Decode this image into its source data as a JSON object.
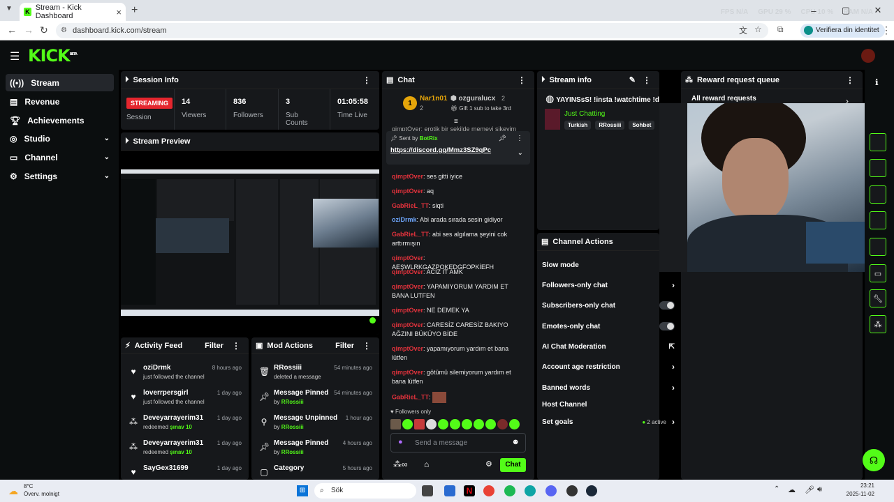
{
  "browser": {
    "tab_title": "Stream - Kick Dashboard",
    "url": "dashboard.kick.com/stream",
    "verify_label": "Verifiera din identitet",
    "stats": [
      "FPS N/A",
      "GPU 29 %",
      "CPU 10 %",
      "RAM N/A"
    ]
  },
  "kick": {
    "logo": "KICK",
    "logo_sup": "BETA"
  },
  "sidebar": {
    "items": [
      {
        "label": "Stream"
      },
      {
        "label": "Revenue"
      },
      {
        "label": "Achievements"
      },
      {
        "label": "Studio"
      },
      {
        "label": "Channel"
      },
      {
        "label": "Settings"
      }
    ]
  },
  "session": {
    "title": "Session Info",
    "badge": "STREAMING",
    "session_label": "Session",
    "viewers": "14",
    "viewers_label": "Viewers",
    "followers": "836",
    "followers_label": "Followers",
    "subs": "3",
    "subs_label": "Sub Counts",
    "time": "01:05:58",
    "time_label": "Time Live"
  },
  "preview": {
    "title": "Stream Preview"
  },
  "activity": {
    "title": "Activity Feed",
    "filter": "Filter",
    "rows": [
      {
        "who": "oziDrmk",
        "what": "just followed the channel",
        "when": "8 hours ago"
      },
      {
        "who": "loverrpersgirl",
        "what": "just followed the channel",
        "when": "1 day ago"
      },
      {
        "who": "Deveyarrayerim31",
        "what": "redeemed",
        "reward": "şınav 10",
        "when": "1 day ago"
      },
      {
        "who": "Deveyarrayerim31",
        "what": "redeemed",
        "reward": "şınav 10",
        "when": "1 day ago"
      },
      {
        "who": "SayGex31699",
        "what": "",
        "when": "1 day ago"
      }
    ]
  },
  "mod": {
    "title": "Mod Actions",
    "filter": "Filter",
    "rows": [
      {
        "who": "RRossiii",
        "what": "deleted a message",
        "when": "54 minutes ago"
      },
      {
        "who": "Message Pinned",
        "what": "by",
        "by": "RRossiii",
        "when": "54 minutes ago"
      },
      {
        "who": "Message Unpinned",
        "what": "by",
        "by": "RRossiii",
        "when": "1 hour ago"
      },
      {
        "who": "Message Pinned",
        "what": "by",
        "by": "RRossiii",
        "when": "4 hours ago"
      },
      {
        "who": "Category",
        "what": "",
        "when": "5 hours ago"
      }
    ]
  },
  "chat": {
    "title": "Chat",
    "top1_name": "Nar1n01",
    "top1_count": "2",
    "top2_name": "ozguralucx",
    "top2_count": "2",
    "gift_text": "Gift 1 sub to take 3rd",
    "pinned_sent_by": "Sent by",
    "pinned_user": "BotRix",
    "pinned_link": "https://discord.gg/Mmz3SZ9qPc",
    "partial_top": "qimptOver: erotik bir şekilde memeyi sikeyim",
    "messages": [
      {
        "user": "qimptOver",
        "text": "ses gitti iyice"
      },
      {
        "user": "qimptOver",
        "text": "aq"
      },
      {
        "user": "GabRieL_TT",
        "text": "siqti"
      },
      {
        "user": "oziDrmk",
        "text": "Abi arada sırada sesin gidiyor"
      },
      {
        "user": "GabRieL_TT",
        "text": "abi ses algılama şeyini cok arttırmışın"
      },
      {
        "user": "qimptOver",
        "text": "AEŞWLRKGAZPOKEDGFOPKİEFH"
      },
      {
        "user": "qimptOver",
        "text": "ACİZ İT AMK"
      },
      {
        "user": "qimptOver",
        "text": "YAPAMIYORUM YARDIM ET BANA LUTFEN"
      },
      {
        "user": "qimptOver",
        "text": "NE DEMEK YA"
      },
      {
        "user": "qimptOver",
        "text": "CARESİZ CARESİZ BAKIYO AĞZINI BÜKÜYO BİDE"
      },
      {
        "user": "qimptOver",
        "text": "yapamıyorum yardım et bana lütfen"
      },
      {
        "user": "qimptOver",
        "text": "götümü silemiyorum yardım et bana lütfen"
      },
      {
        "user": "GabRieL_TT",
        "text": ""
      }
    ],
    "followers_only": "Followers only",
    "placeholder": "Send a message",
    "send": "Chat"
  },
  "stream_info": {
    "title": "Stream info",
    "stream_title": "YAYINSsS! !insta !watchtime !dc",
    "category": "Just Chatting",
    "tags": [
      "Turkish",
      "RRossiii",
      "Sohbet"
    ]
  },
  "actions": {
    "title": "Channel Actions",
    "rows": [
      {
        "label": "Slow mode"
      },
      {
        "label": "Followers-only chat"
      },
      {
        "label": "Subscribers-only chat"
      },
      {
        "label": "Emotes-only chat"
      },
      {
        "label": "AI Chat Moderation"
      },
      {
        "label": "Account age restriction"
      },
      {
        "label": "Banned words"
      },
      {
        "label": "Host Channel"
      },
      {
        "label": "Set goals",
        "extra": "2 active"
      }
    ]
  },
  "rewards": {
    "title": "Reward request queue",
    "all": "All reward requests"
  },
  "taskbar": {
    "weather_temp": "8°C",
    "weather_desc": "Överv. molnigt",
    "search": "Sök",
    "time": "23:21",
    "date": "2025-11-02"
  }
}
